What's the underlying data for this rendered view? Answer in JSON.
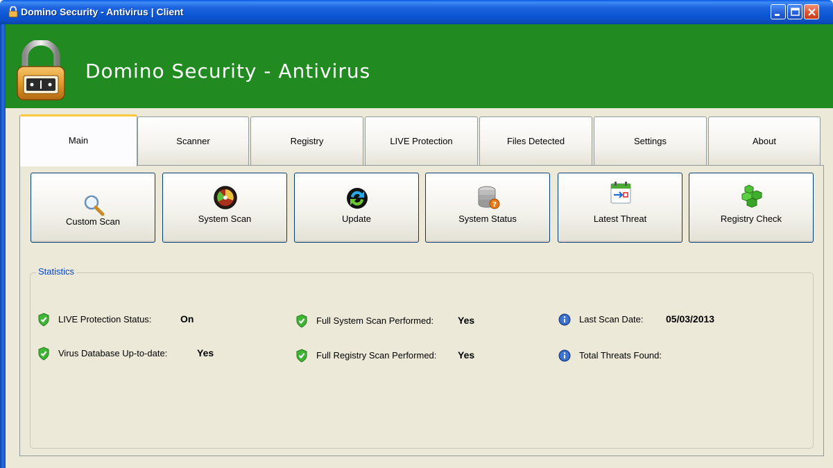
{
  "window": {
    "title": "Domino Security - Antivirus | Client",
    "colors": {
      "titlebar": "#0b4fc4",
      "header": "#218b21",
      "body": "#ece9d8",
      "active_tab_accent": "#ffc83c"
    }
  },
  "header": {
    "app_title": "Domino Security - Antivirus",
    "logo_icon": "padlock-icon"
  },
  "tabs": [
    {
      "label": "Main",
      "active": true
    },
    {
      "label": "Scanner"
    },
    {
      "label": "Registry"
    },
    {
      "label": "LIVE Protection"
    },
    {
      "label": "Files Detected"
    },
    {
      "label": "Settings"
    },
    {
      "label": "About"
    }
  ],
  "actions": [
    {
      "label": "Custom Scan",
      "icon": "magnifier-icon"
    },
    {
      "label": "System Scan",
      "icon": "radar-icon"
    },
    {
      "label": "Update",
      "icon": "refresh-globe-icon"
    },
    {
      "label": "System Status",
      "icon": "database-help-icon"
    },
    {
      "label": "Latest Threat",
      "icon": "calendar-arrow-icon"
    },
    {
      "label": "Registry Check",
      "icon": "green-cubes-icon"
    }
  ],
  "statistics": {
    "title": "Statistics",
    "items": [
      {
        "label": "LIVE Protection Status:",
        "value": "On",
        "icon": "green-shield-check-icon"
      },
      {
        "label": "Virus Database Up-to-date:",
        "value": "Yes",
        "icon": "green-shield-check-icon"
      },
      {
        "label": "Full System Scan Performed:",
        "value": "Yes",
        "icon": "green-shield-check-icon"
      },
      {
        "label": "Full Registry Scan Performed:",
        "value": "Yes",
        "icon": "green-shield-check-icon"
      },
      {
        "label": "Last Scan Date:",
        "value": "05/03/2013",
        "icon": "info-icon"
      },
      {
        "label": "Total Threats Found:",
        "value": "",
        "icon": "info-icon"
      }
    ]
  }
}
